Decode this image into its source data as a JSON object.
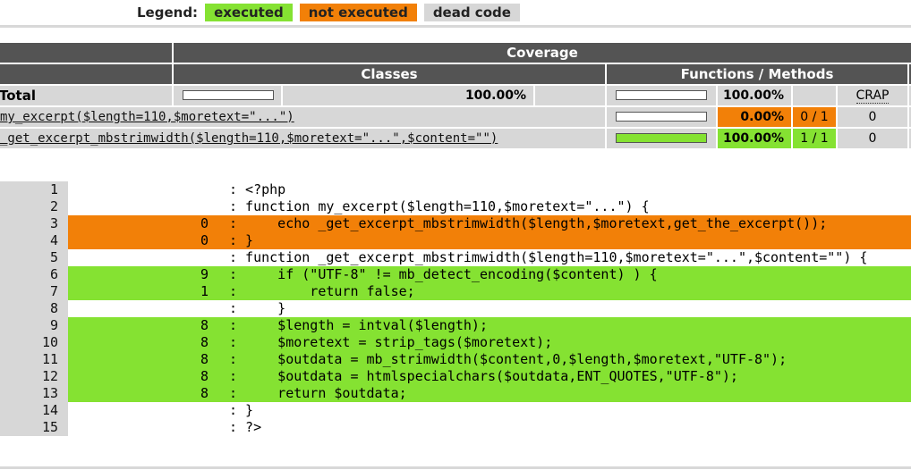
{
  "legend": {
    "title": "Legend:",
    "items": [
      {
        "label": "executed",
        "color": "#85e232"
      },
      {
        "label": "not executed",
        "color": "#f28008"
      },
      {
        "label": "dead code",
        "color": "#d7d7d7"
      }
    ]
  },
  "coverage": {
    "header": "Coverage",
    "classes_header": "Classes",
    "functions_header": "Functions / Methods",
    "crap_label": "CRAP",
    "rows": [
      {
        "name": "Total",
        "classes_pct": "100.00%",
        "func_pct": "100.00%",
        "func_ratio": "",
        "crap": "",
        "classes_fill": 0,
        "func_fill": 0,
        "status": "total"
      },
      {
        "name": "my_excerpt($length=110,$moretext=\"...\")",
        "func_pct": "0.00%",
        "func_ratio": "0 / 1",
        "crap": "0",
        "func_fill": 0,
        "status": "low"
      },
      {
        "name": "_get_excerpt_mbstrimwidth($length=110,$moretext=\"...\",$content=\"\")",
        "func_pct": "100.00%",
        "func_ratio": "1 / 1",
        "crap": "0",
        "func_fill": 1,
        "status": "high"
      }
    ]
  },
  "source": {
    "lines": [
      {
        "n": "1",
        "count": "",
        "code": ": <?php",
        "status": "none"
      },
      {
        "n": "2",
        "count": "",
        "code": ": function my_excerpt($length=110,$moretext=\"...\") {",
        "status": "none"
      },
      {
        "n": "3",
        "count": "0",
        "code": ":     echo _get_excerpt_mbstrimwidth($length,$moretext,get_the_excerpt());",
        "status": "not-executed"
      },
      {
        "n": "4",
        "count": "0",
        "code": ": }",
        "status": "not-executed"
      },
      {
        "n": "5",
        "count": "",
        "code": ": function _get_excerpt_mbstrimwidth($length=110,$moretext=\"...\",$content=\"\") {",
        "status": "none"
      },
      {
        "n": "6",
        "count": "9",
        "code": ":     if (\"UTF-8\" != mb_detect_encoding($content) ) {",
        "status": "executed"
      },
      {
        "n": "7",
        "count": "1",
        "code": ":         return false;",
        "status": "executed"
      },
      {
        "n": "8",
        "count": "",
        "code": ":     }",
        "status": "none"
      },
      {
        "n": "9",
        "count": "8",
        "code": ":     $length = intval($length);",
        "status": "executed"
      },
      {
        "n": "10",
        "count": "8",
        "code": ":     $moretext = strip_tags($moretext);",
        "status": "executed"
      },
      {
        "n": "11",
        "count": "8",
        "code": ":     $outdata = mb_strimwidth($content,0,$length,$moretext,\"UTF-8\");",
        "status": "executed"
      },
      {
        "n": "12",
        "count": "8",
        "code": ":     $outdata = htmlspecialchars($outdata,ENT_QUOTES,\"UTF-8\");",
        "status": "executed"
      },
      {
        "n": "13",
        "count": "8",
        "code": ":     return $outdata;",
        "status": "executed"
      },
      {
        "n": "14",
        "count": "",
        "code": ": }",
        "status": "none"
      },
      {
        "n": "15",
        "count": "",
        "code": ": ?>",
        "status": "none"
      }
    ]
  }
}
